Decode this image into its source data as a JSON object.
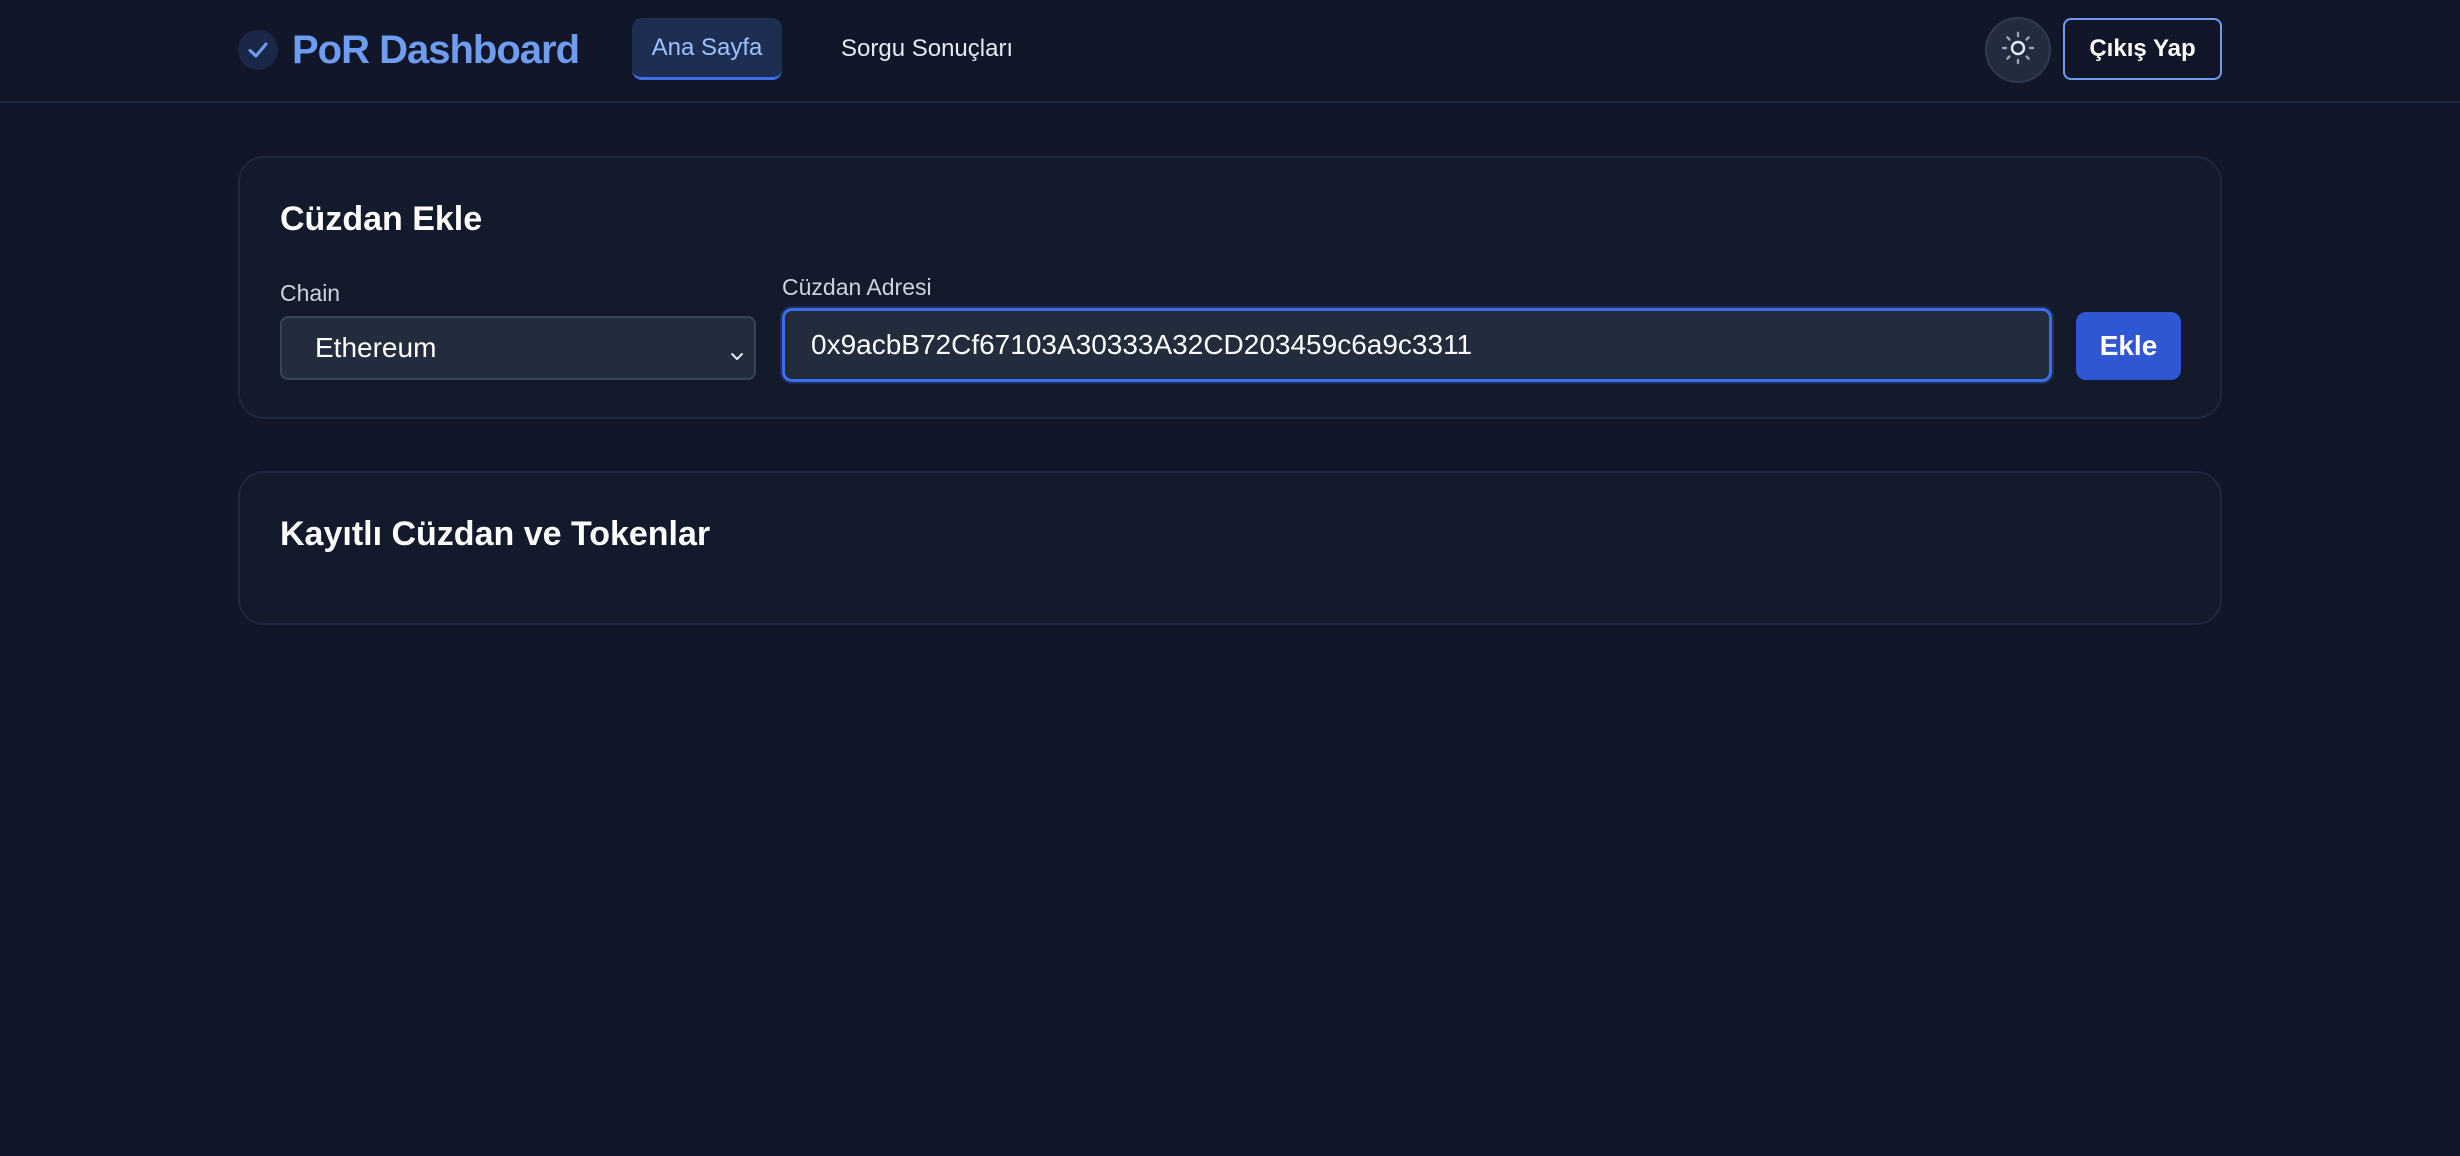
{
  "header": {
    "brand_title": "PoR Dashboard",
    "brand_icon": "check-icon",
    "tabs": [
      {
        "label": "Ana Sayfa",
        "active": true
      },
      {
        "label": "Sorgu Sonuçları",
        "active": false
      }
    ],
    "theme_icon": "sun-icon",
    "logout_label": "Çıkış Yap"
  },
  "wallet_form": {
    "title": "Cüzdan Ekle",
    "chain_label": "Chain",
    "chain_value": "Ethereum",
    "address_label": "Cüzdan Adresi",
    "address_value": "0x9acbB72Cf67103A30333A32CD203459c6a9c3311",
    "submit_label": "Ekle"
  },
  "saved_section": {
    "title": "Kayıtlı Cüzdan ve Tokenlar"
  },
  "colors": {
    "background": "#111729",
    "card": "#121a2c",
    "accent": "#6d9cf0",
    "primary_button": "#2f56d3",
    "focus_ring": "#3b6ee8"
  }
}
